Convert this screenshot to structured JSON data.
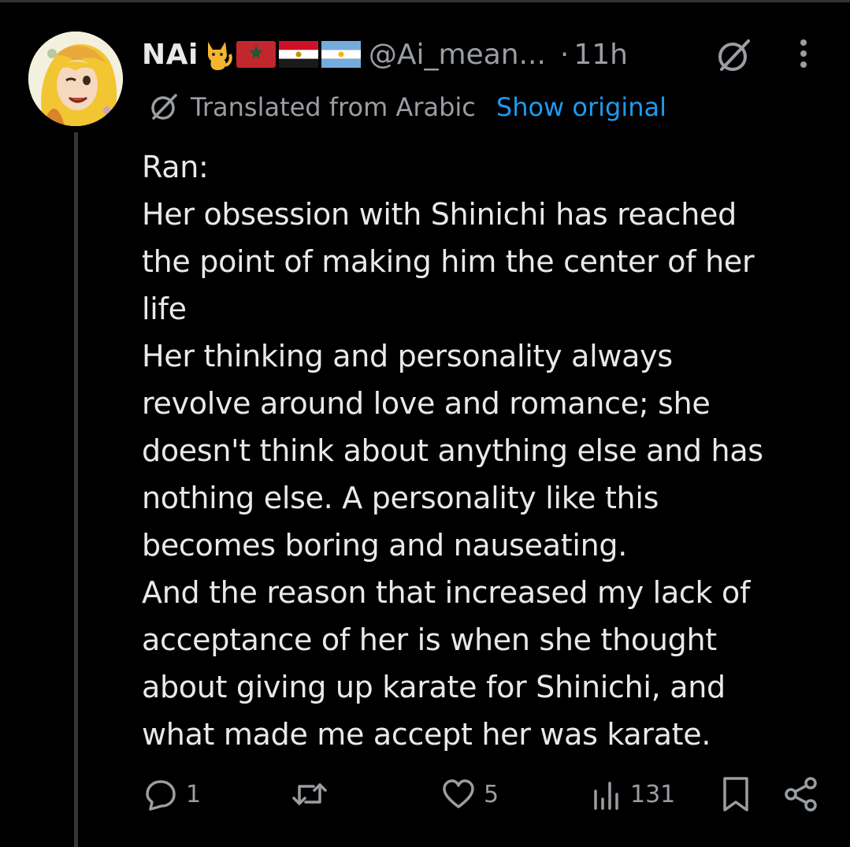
{
  "post": {
    "display_name": "NAi",
    "handle": "@Ai_mean...",
    "separator": "·",
    "time": "11h",
    "translated_label": "Translated from Arabic",
    "show_original_label": "Show original",
    "text_lines": [
      "Ran:",
      "Her obsession with Shinichi has reached",
      "the point of making him the center of her",
      "life",
      "Her thinking and personality always",
      "revolve around love and romance; she",
      "doesn't think about anything else and has",
      "nothing else. A personality like this",
      "becomes boring and nauseating.",
      "And the reason that increased my lack of",
      "acceptance of her is when she thought",
      "about giving up karate for Shinichi, and",
      "what made me accept her was karate."
    ]
  },
  "badges": [
    "cat-emoji",
    "morocco-flag",
    "egypt-flag",
    "argentina-flag"
  ],
  "actions": {
    "replies": "1",
    "reposts": "",
    "likes": "5",
    "views": "131"
  },
  "colors": {
    "background": "#000000",
    "text": "#e7e9ea",
    "secondary": "#9a9ea3",
    "link": "#1d9bf0",
    "thread_line": "#333639"
  },
  "icons": [
    "grok-icon",
    "more-icon",
    "translate-icon",
    "reply-icon",
    "repost-icon",
    "like-icon",
    "views-icon",
    "bookmark-icon",
    "share-icon"
  ]
}
